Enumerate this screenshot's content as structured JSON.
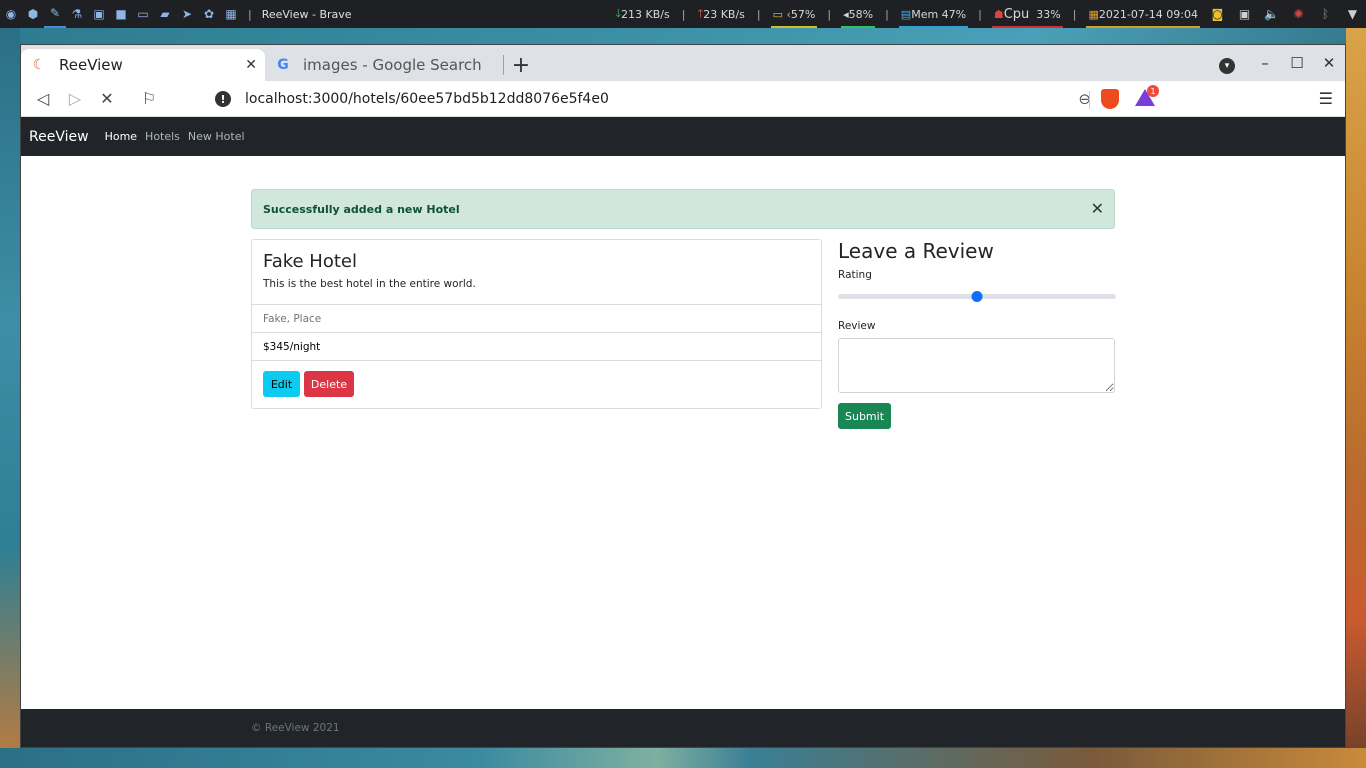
{
  "taskbar": {
    "window_title": "ReeView - Brave",
    "net_down": "213 KB/s",
    "net_up": "23 KB/s",
    "battery": "57%",
    "volume": "58%",
    "mem": "Mem 47%",
    "cpu_label": "Cpu",
    "cpu": "33%",
    "datetime": "2021-07-14 09:04"
  },
  "browser": {
    "tabs": [
      {
        "title": "ReeView",
        "active": true
      },
      {
        "title": "images - Google Search",
        "active": false
      }
    ],
    "url": "localhost:3000/hotels/60ee57bd5b12dd8076e5f4e0",
    "rewards_badge": "1"
  },
  "navbar": {
    "brand": "ReeView",
    "links": [
      "Home",
      "Hotels",
      "New Hotel"
    ]
  },
  "alert": {
    "message": "Successfully added a new Hotel"
  },
  "hotel": {
    "title": "Fake Hotel",
    "description": "This is the best hotel in the entire world.",
    "location": "Fake, Place",
    "price": "$345/night",
    "edit_label": "Edit",
    "delete_label": "Delete"
  },
  "review_form": {
    "heading": "Leave a Review",
    "rating_label": "Rating",
    "rating_fraction": 0.5,
    "review_label": "Review",
    "review_value": "",
    "submit_label": "Submit"
  },
  "footer": {
    "text": "© ReeView 2021"
  }
}
